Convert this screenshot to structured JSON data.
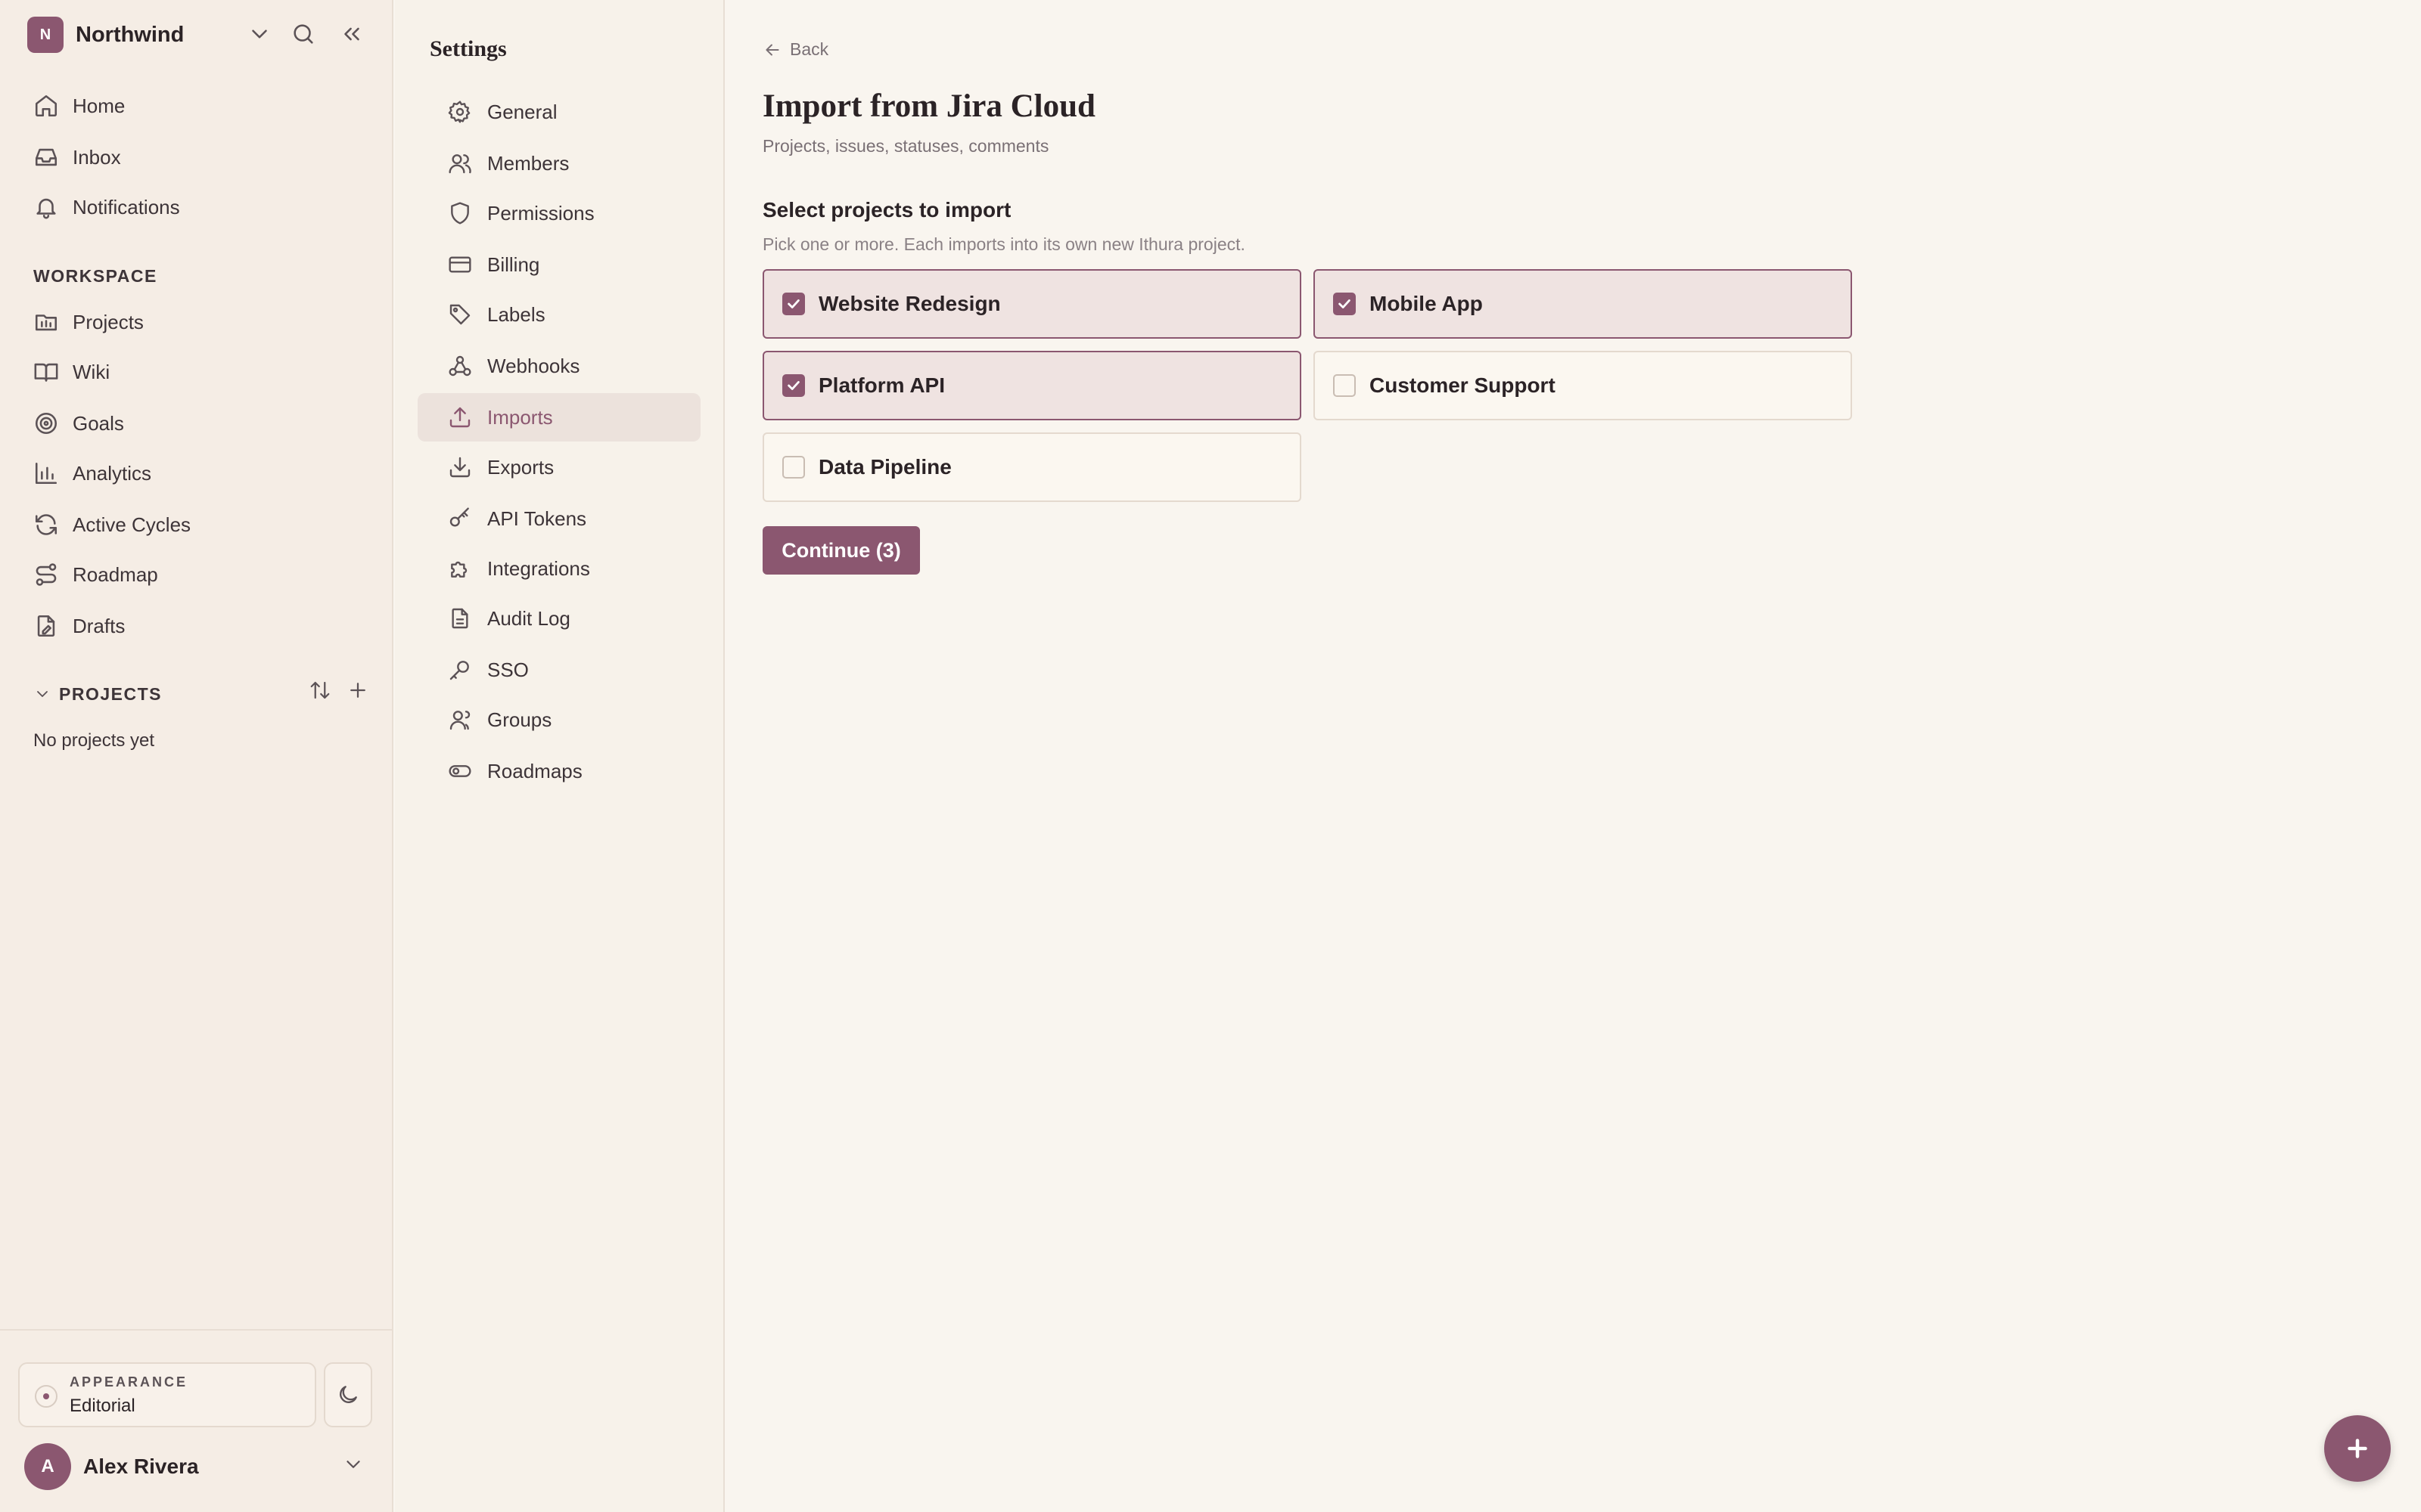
{
  "workspace": {
    "initial": "N",
    "name": "Northwind"
  },
  "nav": {
    "home": "Home",
    "inbox": "Inbox",
    "notifications": "Notifications",
    "workspace_title": "WORKSPACE",
    "projects": "Projects",
    "wiki": "Wiki",
    "goals": "Goals",
    "analytics": "Analytics",
    "active_cycles": "Active Cycles",
    "roadmap": "Roadmap",
    "drafts": "Drafts"
  },
  "projects_section": {
    "title": "PROJECTS",
    "empty": "No projects yet"
  },
  "appearance": {
    "caption": "APPEARANCE",
    "value": "Editorial"
  },
  "user": {
    "initial": "A",
    "name": "Alex Rivera"
  },
  "settings": {
    "title": "Settings",
    "items": [
      {
        "label": "General",
        "icon": "gear-icon"
      },
      {
        "label": "Members",
        "icon": "users-icon"
      },
      {
        "label": "Permissions",
        "icon": "shield-icon"
      },
      {
        "label": "Billing",
        "icon": "credit-card-icon"
      },
      {
        "label": "Labels",
        "icon": "tag-icon"
      },
      {
        "label": "Webhooks",
        "icon": "webhook-icon"
      },
      {
        "label": "Imports",
        "icon": "upload-icon",
        "active": true
      },
      {
        "label": "Exports",
        "icon": "download-icon"
      },
      {
        "label": "API Tokens",
        "icon": "key-icon"
      },
      {
        "label": "Integrations",
        "icon": "puzzle-icon"
      },
      {
        "label": "Audit Log",
        "icon": "document-icon"
      },
      {
        "label": "SSO",
        "icon": "key-round-icon"
      },
      {
        "label": "Groups",
        "icon": "group-icon"
      },
      {
        "label": "Roadmaps",
        "icon": "toggle-icon"
      }
    ]
  },
  "main": {
    "back": "Back",
    "title": "Import from Jira Cloud",
    "subtitle": "Projects, issues, statuses, comments",
    "section_title": "Select projects to import",
    "section_hint": "Pick one or more. Each imports into its own new Ithura project.",
    "projects": [
      {
        "name": "Website Redesign",
        "checked": true
      },
      {
        "name": "Mobile App",
        "checked": true
      },
      {
        "name": "Platform API",
        "checked": true
      },
      {
        "name": "Customer Support",
        "checked": false
      },
      {
        "name": "Data Pipeline",
        "checked": false
      }
    ],
    "continue_label": "Continue (3)"
  },
  "colors": {
    "accent": "#8b5770",
    "sidebar_bg": "#f5ede5",
    "main_bg": "#f9f5ef"
  }
}
